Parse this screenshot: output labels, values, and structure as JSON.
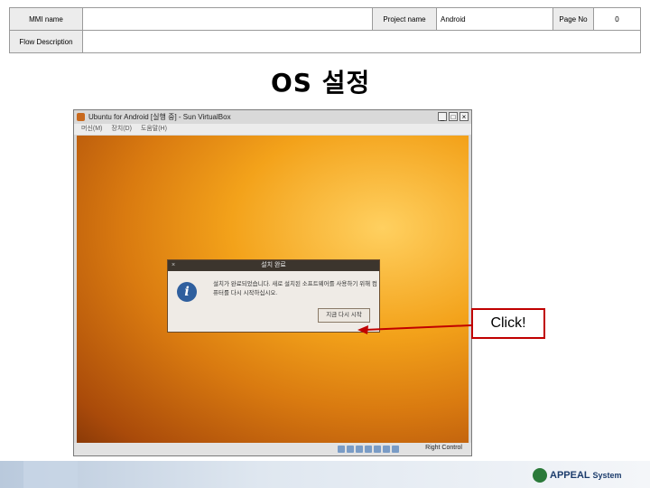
{
  "header": {
    "mmi_label": "MMI name",
    "mmi_value": "",
    "project_label": "Project name",
    "project_value": "Android",
    "page_label": "Page No",
    "page_value": "0",
    "flow_label": "Flow Description",
    "flow_value": ""
  },
  "slide_title": "OS 설정",
  "vm_window": {
    "title": "Ubuntu for Android [실행 중] - Sun VirtualBox",
    "menu": [
      "머신(M)",
      "장치(D)",
      "도움말(H)"
    ],
    "status_text": "Right Control"
  },
  "dialog": {
    "title": "설치 완료",
    "message": "설치가 완료되었습니다. 새로 설치된 소프트웨어를 사용하기 위해 컴퓨터를 다시 시작하십시오.",
    "button": "지금 다시 시작"
  },
  "annotation": {
    "label": "Click!",
    "color": "#c00000"
  },
  "footer": {
    "logo_text": "APPEAL",
    "logo_sub": "System"
  }
}
